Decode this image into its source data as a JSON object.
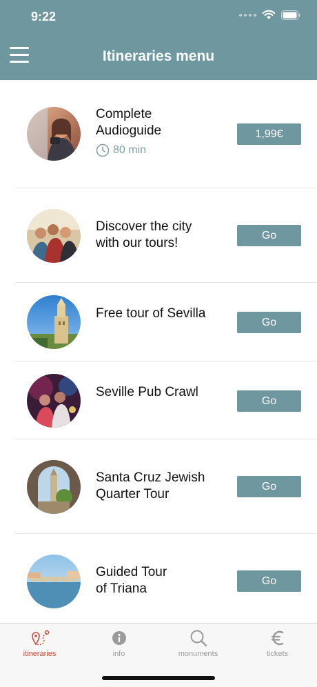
{
  "status_bar": {
    "time": "9:22"
  },
  "header": {
    "title": "Itineraries menu",
    "menu_icon": "hamburger-menu-icon"
  },
  "itineraries": [
    {
      "title_lines": [
        "Complete",
        "Audioguide"
      ],
      "duration": "80 min",
      "button": "1,99€"
    },
    {
      "title_lines": [
        "Discover the city",
        "with our tours!"
      ],
      "button": "Go"
    },
    {
      "title_lines": [
        "Free tour of Sevilla"
      ],
      "button": "Go"
    },
    {
      "title_lines": [
        "Seville Pub Crawl"
      ],
      "button": "Go"
    },
    {
      "title_lines": [
        "Santa Cruz Jewish",
        "Quarter Tour"
      ],
      "button": "Go"
    },
    {
      "title_lines": [
        "Guided Tour",
        "of Triana"
      ],
      "button": "Go"
    }
  ],
  "tabs": [
    {
      "label": "itineraries",
      "icon": "map-pin-route-icon",
      "active": true
    },
    {
      "label": "info",
      "icon": "info-circle-icon",
      "active": false
    },
    {
      "label": "monuments",
      "icon": "search-icon",
      "active": false
    },
    {
      "label": "tickets",
      "icon": "euro-icon",
      "active": false
    }
  ],
  "colors": {
    "accent": "#6f97a0",
    "active_tab": "#d0463b",
    "inactive_tab": "#9b9b9b"
  }
}
